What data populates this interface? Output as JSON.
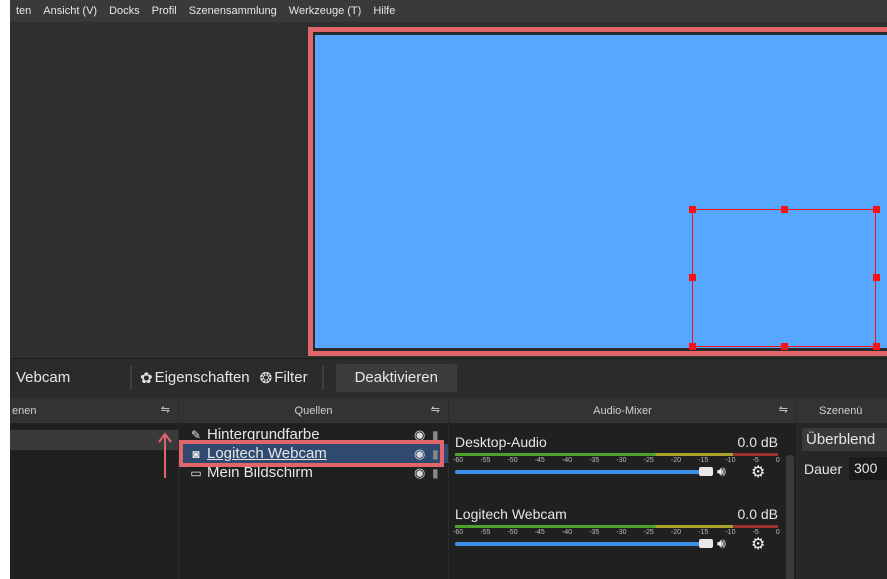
{
  "menu": [
    "ten",
    "Ansicht (V)",
    "Docks",
    "Profil",
    "Szenensammlung",
    "Werkzeuge (T)",
    "Hilfe"
  ],
  "colors": {
    "canvas": "#57a6ff",
    "highlight": "#e0666b",
    "selection": "#ff1010"
  },
  "toolbar": {
    "source_name": "Vebcam",
    "properties_label": "Eigenschaften",
    "filter_label": "Filter",
    "deactivate_label": "Deaktivieren",
    "properties_icon": "gear-icon",
    "filter_icon": "filter-icon"
  },
  "docks": {
    "scenes": {
      "title": "enen"
    },
    "sources": {
      "title": "Quellen",
      "items": [
        {
          "label": "Hintergrundfarbe",
          "icon": "brush-icon"
        },
        {
          "label": "Logitech Webcam",
          "icon": "camera-icon"
        },
        {
          "label": "Mein Bildschirm",
          "icon": "monitor-icon"
        }
      ]
    },
    "mixer": {
      "title": "Audio-Mixer",
      "channels": [
        {
          "name": "Desktop-Audio",
          "db": "0.0 dB"
        },
        {
          "name": "Logitech Webcam",
          "db": "0.0 dB"
        }
      ],
      "ticks": [
        "-60",
        "-55",
        "-50",
        "-45",
        "-40",
        "-35",
        "-30",
        "-25",
        "-20",
        "-15",
        "-10",
        "-5",
        "0"
      ]
    },
    "transitions": {
      "title": "Szenenü",
      "select": "Überblend",
      "duration_label": "Dauer",
      "duration": "300"
    }
  }
}
